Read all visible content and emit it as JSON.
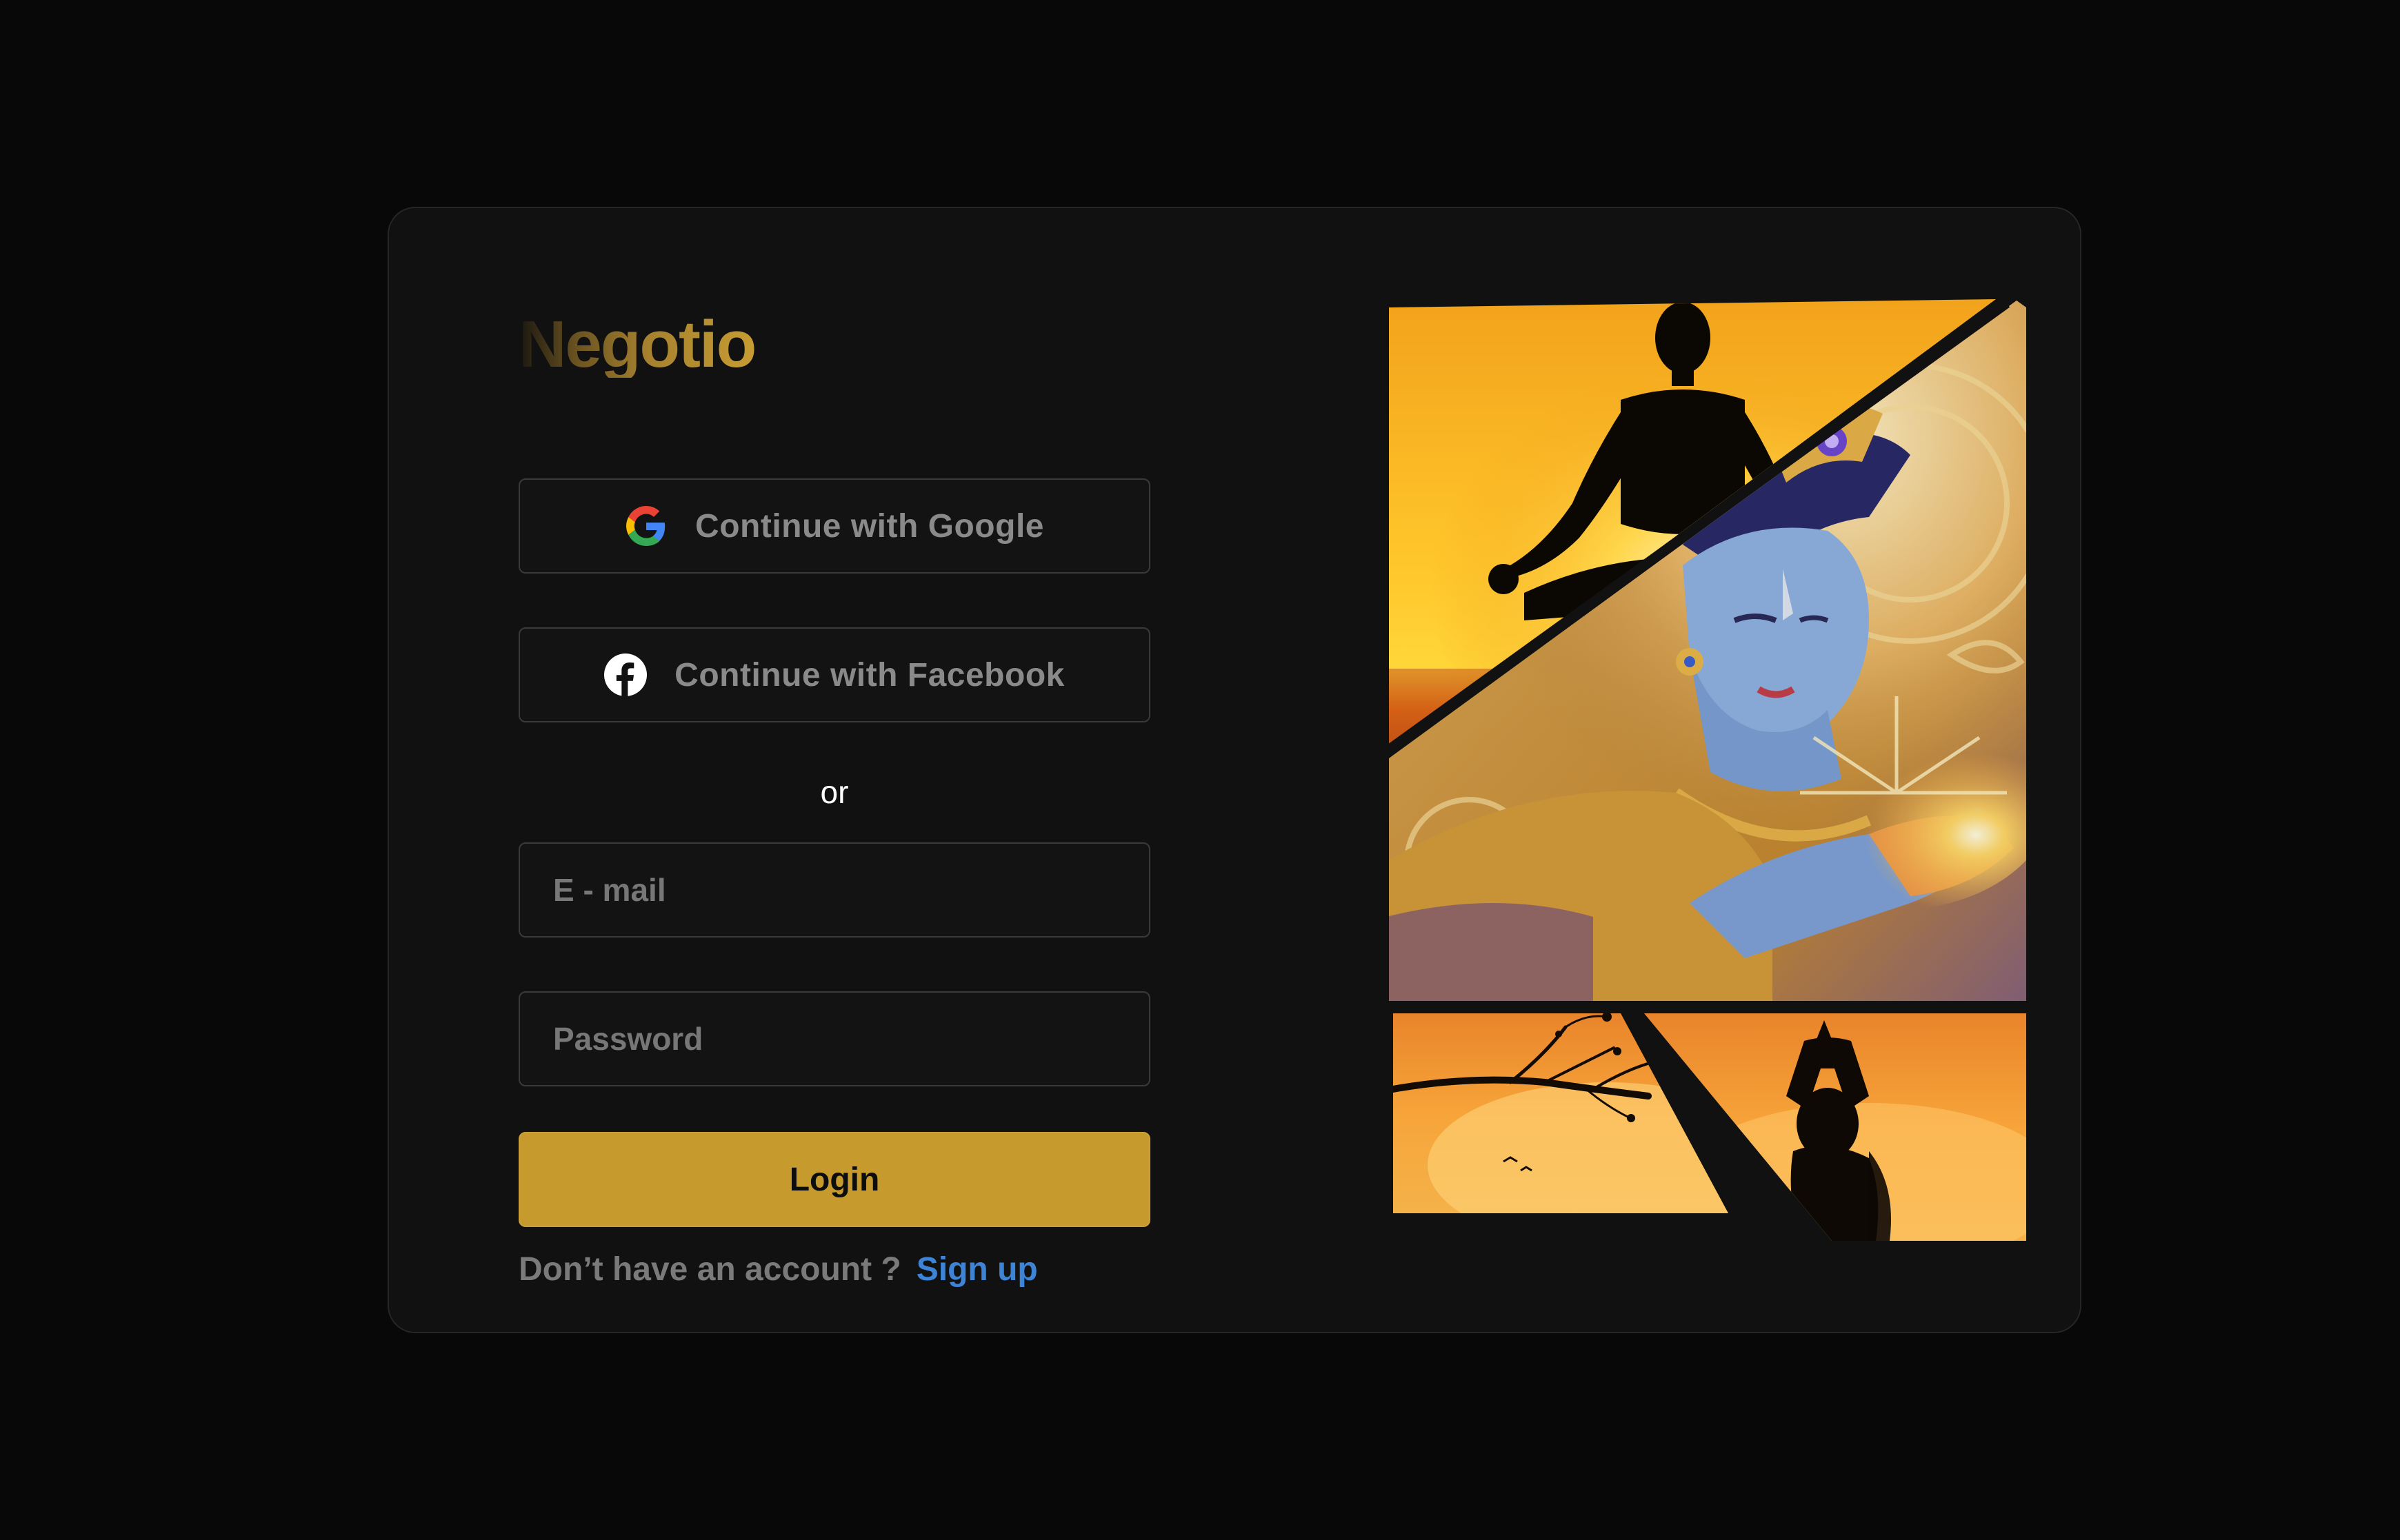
{
  "brand": {
    "name": "Negotio"
  },
  "auth": {
    "google_label": "Continue with Google",
    "facebook_label": "Continue with Facebook",
    "divider_text": "or",
    "email_placeholder": "E - mail",
    "password_placeholder": "Password",
    "login_label": "Login",
    "no_account_text": "Don’t have an account ?",
    "signup_label": "Sign up"
  },
  "icons": {
    "google": "google-icon",
    "facebook": "facebook-icon"
  },
  "collage": {
    "panels": [
      "yoga-meditation-silhouette",
      "krishna-portrait",
      "sunset-branch-birds",
      "yoga-woman-silhouette"
    ]
  },
  "colors": {
    "background": "#080808",
    "card": "#111111",
    "accent": "#c69a2d",
    "link": "#3d84d6"
  }
}
